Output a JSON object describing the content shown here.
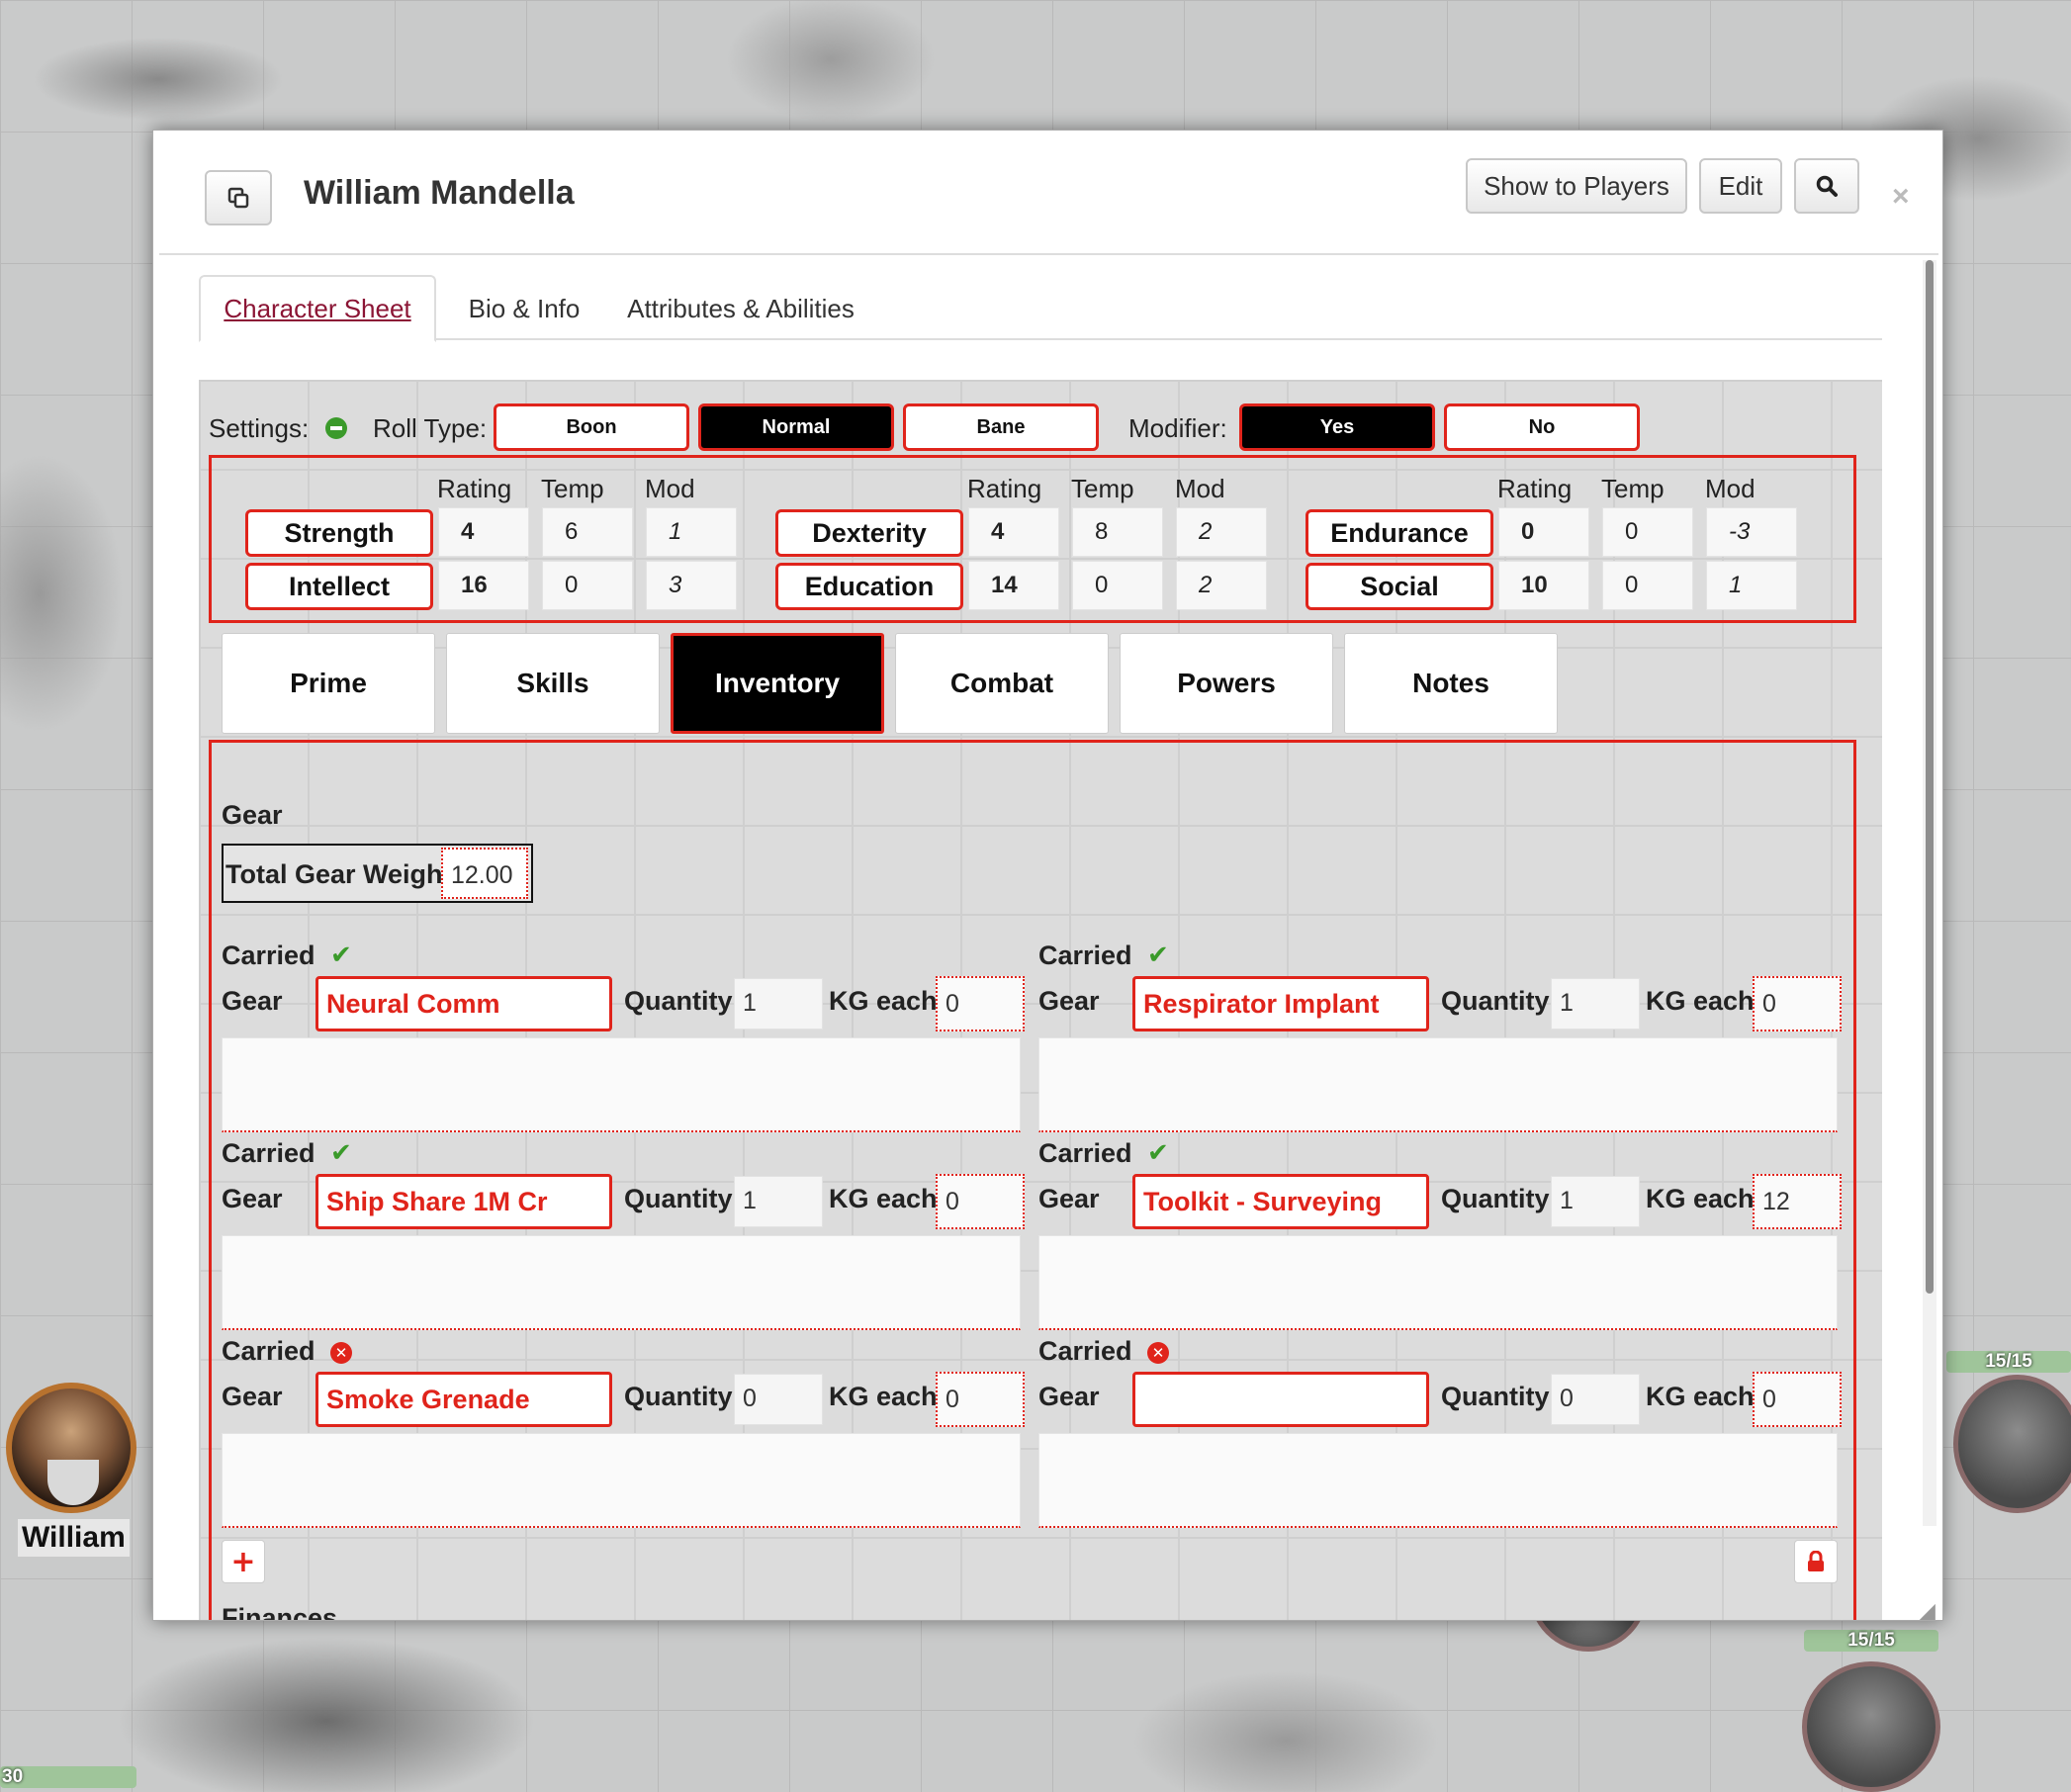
{
  "map": {
    "token_name": "William",
    "hp_left": "30",
    "hp_right_top": "15/15",
    "hp_right_bottom": "15/15"
  },
  "dialog": {
    "title": "William Mandella",
    "show_to_players": "Show to Players",
    "edit": "Edit",
    "search_icon": "search-icon",
    "close": "×",
    "popout_icon": "popout-icon"
  },
  "tabs": [
    "Character Sheet",
    "Bio & Info",
    "Attributes & Abilities"
  ],
  "settings": {
    "label": "Settings:",
    "roll_type_label": "Roll Type:",
    "roll_types": [
      "Boon",
      "Normal",
      "Bane"
    ],
    "roll_type_selected": "Normal",
    "modifier_label": "Modifier:",
    "modifier_options": [
      "Yes",
      "No"
    ],
    "modifier_selected": "Yes"
  },
  "stat_headers": [
    "Rating",
    "Temp",
    "Mod"
  ],
  "stats": [
    {
      "name": "Strength",
      "rating": "4",
      "temp": "6",
      "mod": "1"
    },
    {
      "name": "Intellect",
      "rating": "16",
      "temp": "0",
      "mod": "3"
    },
    {
      "name": "Dexterity",
      "rating": "4",
      "temp": "8",
      "mod": "2"
    },
    {
      "name": "Education",
      "rating": "14",
      "temp": "0",
      "mod": "2"
    },
    {
      "name": "Endurance",
      "rating": "0",
      "temp": "0",
      "mod": "-3"
    },
    {
      "name": "Social",
      "rating": "10",
      "temp": "0",
      "mod": "1"
    }
  ],
  "subtabs": [
    "Prime",
    "Skills",
    "Inventory",
    "Combat",
    "Powers",
    "Notes"
  ],
  "subtab_selected": "Inventory",
  "inventory": {
    "gear_heading": "Gear",
    "total_weight_label": "Total Gear Weight",
    "total_weight": "12.00",
    "carried_label": "Carried",
    "gear_label": "Gear",
    "quantity_label": "Quantity",
    "kg_label": "KG each",
    "items": [
      {
        "carried": true,
        "name": "Neural Comm",
        "quantity": "1",
        "kg": "0"
      },
      {
        "carried": true,
        "name": "Respirator Implant",
        "quantity": "1",
        "kg": "0"
      },
      {
        "carried": true,
        "name": "Ship Share 1M Cr",
        "quantity": "1",
        "kg": "0"
      },
      {
        "carried": true,
        "name": "Toolkit - Surveying",
        "quantity": "1",
        "kg": "12"
      },
      {
        "carried": false,
        "name": "Smoke Grenade",
        "quantity": "0",
        "kg": "0"
      },
      {
        "carried": false,
        "name": "",
        "quantity": "0",
        "kg": "0"
      }
    ],
    "add_icon": "plus-icon",
    "lock_icon": "lock-icon",
    "finances_heading": "Finances"
  }
}
